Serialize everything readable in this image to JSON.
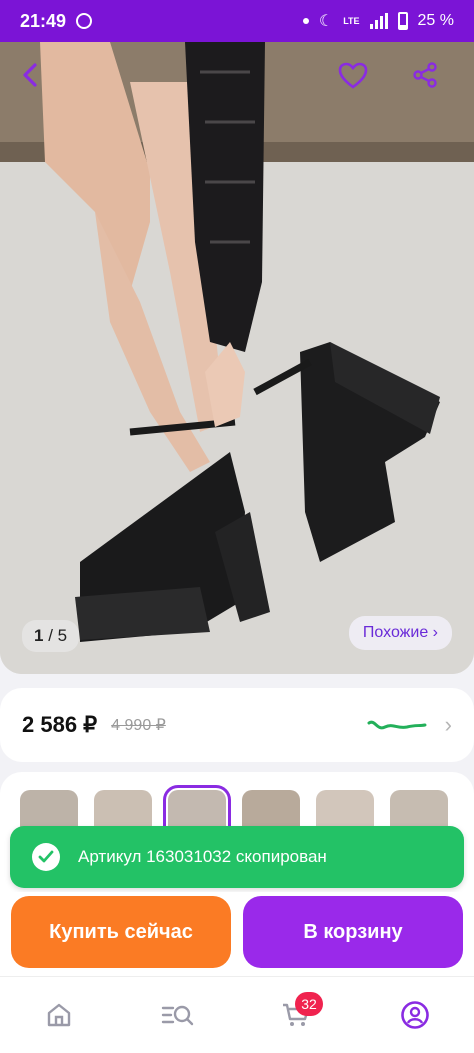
{
  "status_bar": {
    "time": "21:49",
    "network": "LTE",
    "battery": "25 %"
  },
  "gallery": {
    "current": "1",
    "total": "/ 5",
    "similar_label": "Похожие ›"
  },
  "price": {
    "current": "2 586 ₽",
    "old": "4 990 ₽"
  },
  "toast": {
    "text": "Артикул 163031032 скопирован"
  },
  "actions": {
    "buy_now": "Купить сейчас",
    "add_to_cart": "В корзину"
  },
  "tabbar": {
    "cart_badge": "32"
  },
  "colors": {
    "brand": "#7b14d6",
    "buy": "#fb7b24",
    "cart": "#9a29ea",
    "toast": "#23c266",
    "badge": "#f0234f"
  },
  "icons": [
    "back-icon",
    "heart-icon",
    "share-icon",
    "check-icon",
    "chevron-right-icon",
    "home-icon",
    "search-catalog-icon",
    "cart-icon",
    "profile-icon"
  ]
}
